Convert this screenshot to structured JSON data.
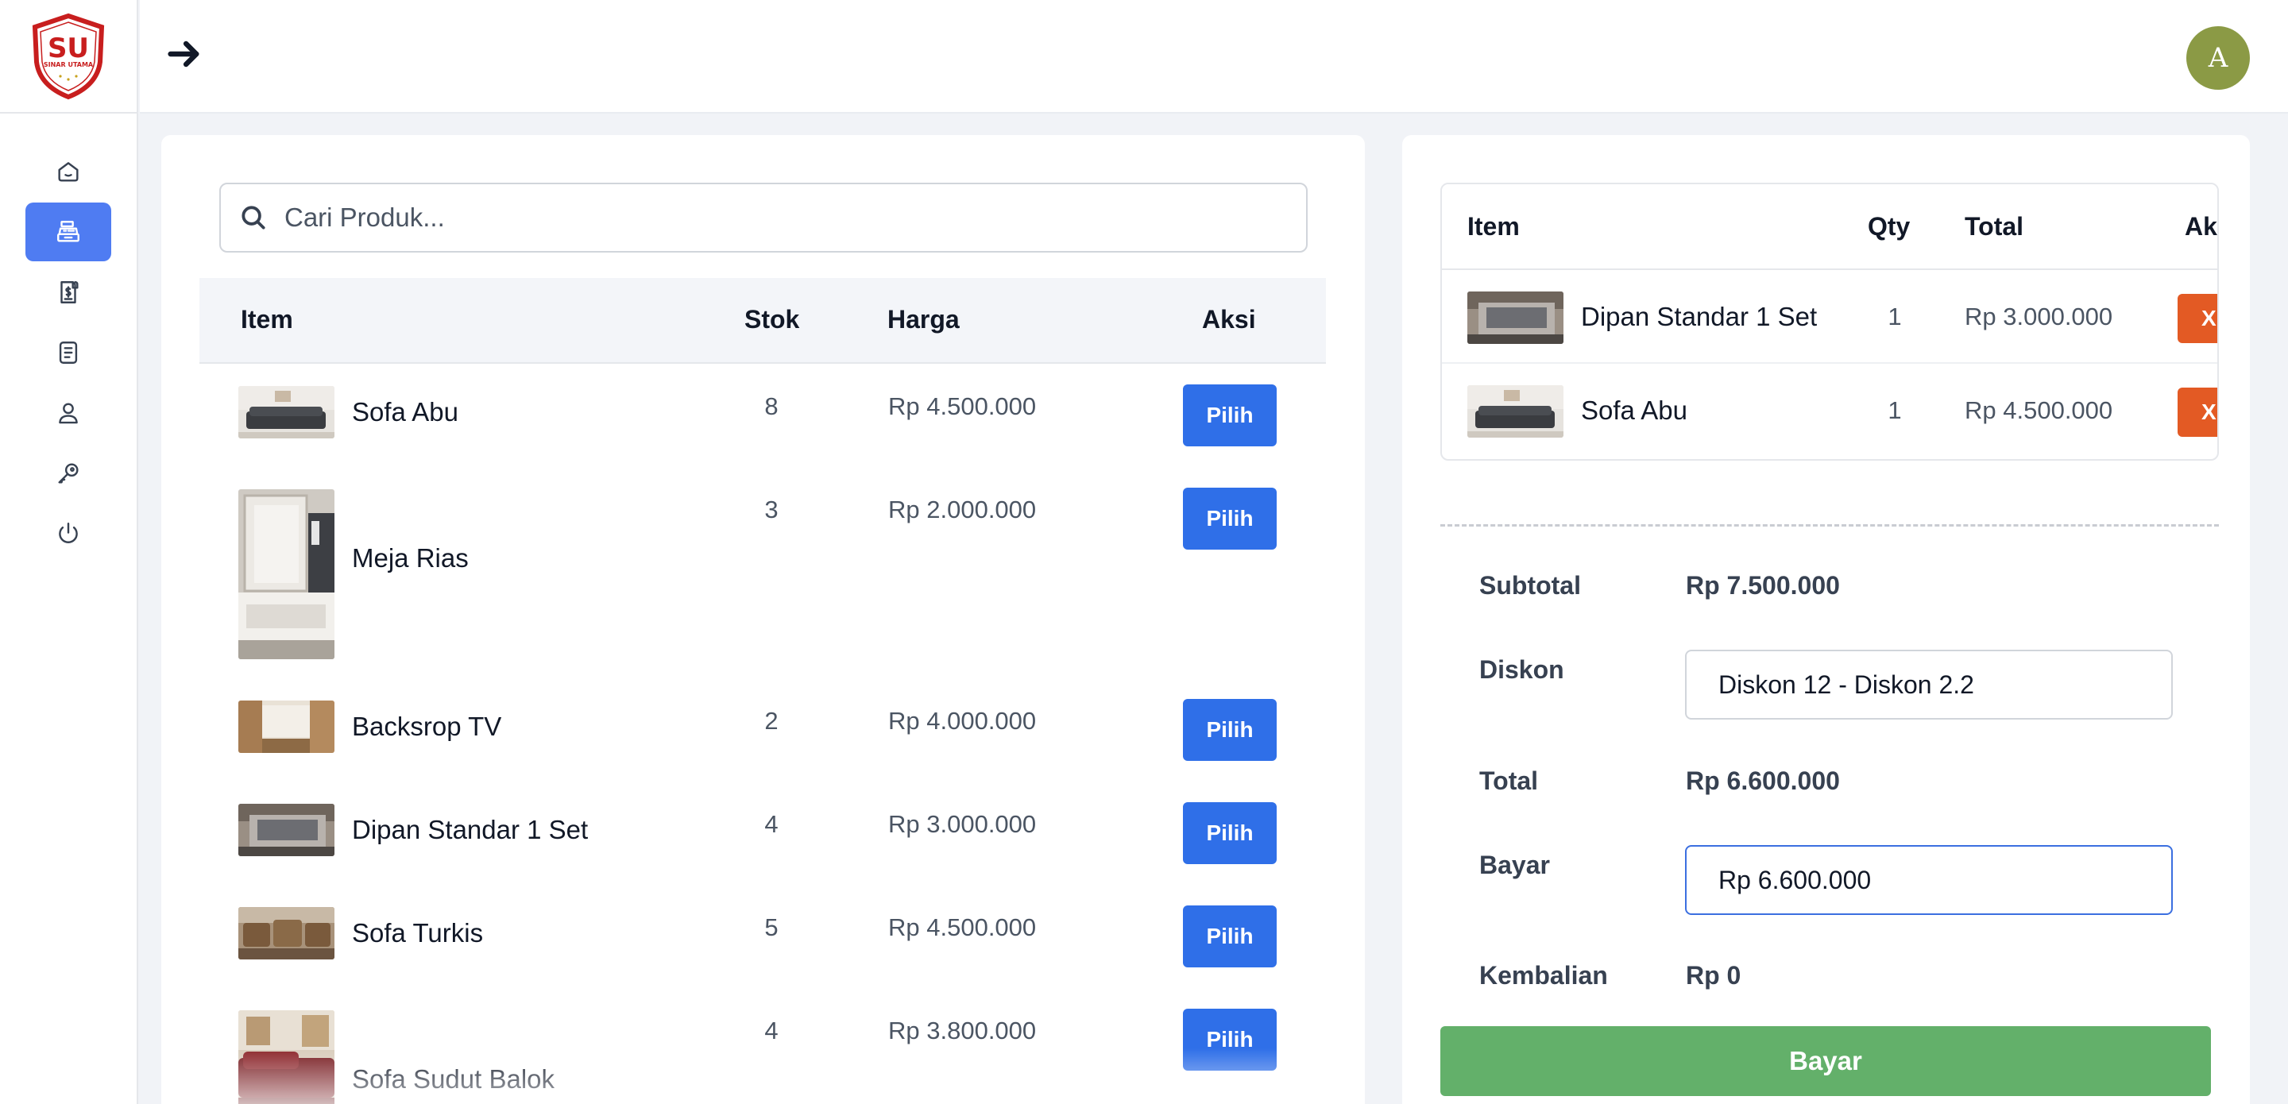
{
  "brand": {
    "logo_text": "SU",
    "logo_subtext": "SINAR UTAMA",
    "logo_color": "#c81e1e"
  },
  "sidebar": {
    "items": [
      {
        "name": "home",
        "icon": "home-icon",
        "active": false
      },
      {
        "name": "kasir",
        "icon": "cash-register-icon",
        "active": true
      },
      {
        "name": "invoice",
        "icon": "receipt-dollar-icon",
        "active": false
      },
      {
        "name": "laporan",
        "icon": "document-icon",
        "active": false
      },
      {
        "name": "user",
        "icon": "user-icon",
        "active": false
      },
      {
        "name": "settings",
        "icon": "key-icon",
        "active": false
      },
      {
        "name": "logout",
        "icon": "power-icon",
        "active": false
      }
    ],
    "active_color": "#4f7cf2"
  },
  "header": {
    "toggle_icon": "arrow-right-icon",
    "avatar_initial": "A",
    "avatar_color": "#8b9a45"
  },
  "search": {
    "placeholder": "Cari Produk...",
    "value": ""
  },
  "products": {
    "columns": {
      "item": "Item",
      "stok": "Stok",
      "harga": "Harga",
      "aksi": "Aksi"
    },
    "rows": [
      {
        "name": "Sofa Abu",
        "stok": "8",
        "harga": "Rp 4.500.000",
        "action": "Pilih"
      },
      {
        "name": "Meja Rias",
        "stok": "3",
        "harga": "Rp 2.000.000",
        "action": "Pilih"
      },
      {
        "name": "Backsrop TV",
        "stok": "2",
        "harga": "Rp 4.000.000",
        "action": "Pilih"
      },
      {
        "name": "Dipan Standar 1 Set",
        "stok": "4",
        "harga": "Rp 3.000.000",
        "action": "Pilih"
      },
      {
        "name": "Sofa Turkis",
        "stok": "5",
        "harga": "Rp 4.500.000",
        "action": "Pilih"
      },
      {
        "name": "Sofa Sudut Balok",
        "stok": "4",
        "harga": "Rp 3.800.000",
        "action": "Pilih"
      }
    ],
    "button_color": "#2f6fe8"
  },
  "cart": {
    "columns": {
      "item": "Item",
      "qty": "Qty",
      "total": "Total",
      "aksi": "Aksi"
    },
    "rows": [
      {
        "name": "Dipan Standar 1 Set",
        "qty": "1",
        "total": "Rp 3.000.000",
        "action": "X"
      },
      {
        "name": "Sofa Abu",
        "qty": "1",
        "total": "Rp 4.500.000",
        "action": "X"
      }
    ],
    "delete_color": "#e35a24"
  },
  "summary": {
    "subtotal_label": "Subtotal",
    "subtotal_value": "Rp 7.500.000",
    "diskon_label": "Diskon",
    "diskon_value": "Diskon 12 - Diskon 2.2",
    "total_label": "Total",
    "total_value": "Rp 6.600.000",
    "bayar_label": "Bayar",
    "bayar_value": "Rp 6.600.000",
    "kembalian_label": "Kembalian",
    "kembalian_value": "Rp 0",
    "pay_button": "Bayar",
    "pay_color": "#63b06a"
  }
}
